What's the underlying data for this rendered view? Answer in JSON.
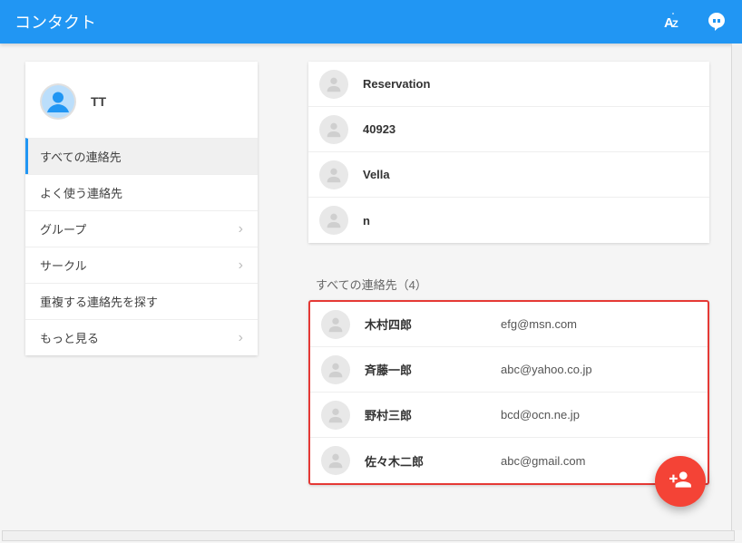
{
  "header": {
    "title": "コンタクト"
  },
  "profile": {
    "name": "TT"
  },
  "sidebar": {
    "items": [
      {
        "label": "すべての連絡先",
        "active": true,
        "expandable": false
      },
      {
        "label": "よく使う連絡先",
        "active": false,
        "expandable": false
      },
      {
        "label": "グループ",
        "active": false,
        "expandable": true
      },
      {
        "label": "サークル",
        "active": false,
        "expandable": true
      },
      {
        "label": "重複する連絡先を探す",
        "active": false,
        "expandable": false
      },
      {
        "label": "もっと見る",
        "active": false,
        "expandable": true
      }
    ]
  },
  "top_contacts": [
    {
      "name": "Reservation"
    },
    {
      "name": "40923"
    },
    {
      "name": "Vella"
    },
    {
      "name": "n"
    }
  ],
  "all_contacts_section": {
    "label": "すべての連絡先（4）"
  },
  "all_contacts": [
    {
      "name": "木村四郎",
      "email": "efg@msn.com"
    },
    {
      "name": "斉藤一郎",
      "email": "abc@yahoo.co.jp"
    },
    {
      "name": "野村三郎",
      "email": "bcd@ocn.ne.jp"
    },
    {
      "name": "佐々木二郎",
      "email": "abc@gmail.com"
    }
  ]
}
